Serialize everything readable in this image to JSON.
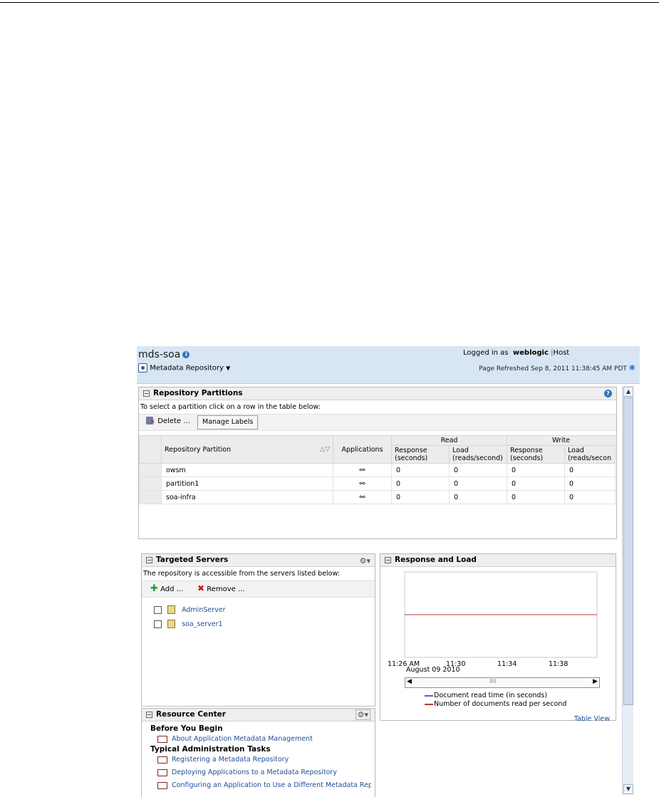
{
  "header": {
    "title": "mds-soa",
    "target_menu": "Metadata Repository",
    "logged_in_label": "Logged in as",
    "user": "weblogic",
    "host_link": "Host",
    "refreshed": "Page Refreshed Sep 8, 2011 11:38:45 AM PDT"
  },
  "partitions": {
    "title": "Repository Partitions",
    "instruction": "To select a partition click on a row in the table below:",
    "delete_label": "Delete ...",
    "manage_labels": "Manage Labels",
    "columns": {
      "partition": "Repository Partition",
      "applications": "Applications",
      "read": "Read",
      "write": "Write",
      "read_response": "Response (seconds)",
      "read_load": "Load (reads/second)",
      "write_response": "Response (seconds)",
      "write_load": "Load (reads/secon"
    },
    "rows": [
      {
        "name": "owsm",
        "r_resp": "0",
        "r_load": "0",
        "w_resp": "0",
        "w_load": "0"
      },
      {
        "name": "partition1",
        "r_resp": "0",
        "r_load": "0",
        "w_resp": "0",
        "w_load": "0"
      },
      {
        "name": "soa-infra",
        "r_resp": "0",
        "r_load": "0",
        "w_resp": "0",
        "w_load": "0"
      }
    ]
  },
  "servers": {
    "title": "Targeted Servers",
    "instruction": "The repository is accessible from the servers listed below:",
    "add_label": "Add ...",
    "remove_label": "Remove ...",
    "items": [
      "AdminServer",
      "soa_server1"
    ]
  },
  "response_load": {
    "title": "Response and Load",
    "date_label": "August 09 2010",
    "table_view": "Table View"
  },
  "chart_data": {
    "type": "line",
    "x": [
      "11:26 AM",
      "11:30",
      "11:34",
      "11:38"
    ],
    "series": [
      {
        "name": "Document read time (in seconds)",
        "values": [
          0,
          0,
          0,
          0
        ],
        "color": "#5a64b4"
      },
      {
        "name": "Number of documents read per second",
        "values": [
          0,
          0,
          0,
          0
        ],
        "color": "#b23a3a"
      }
    ],
    "xlabel": "August 09 2010"
  },
  "resources": {
    "title": "Resource Center",
    "before_heading": "Before You Begin",
    "before_items": [
      "About Application Metadata Management"
    ],
    "tasks_heading": "Typical Administration Tasks",
    "task_items": [
      "Registering a Metadata Repository",
      "Deploying Applications to a Metadata Repository",
      "Configuring an Application to Use a Different Metadata Repos"
    ]
  }
}
